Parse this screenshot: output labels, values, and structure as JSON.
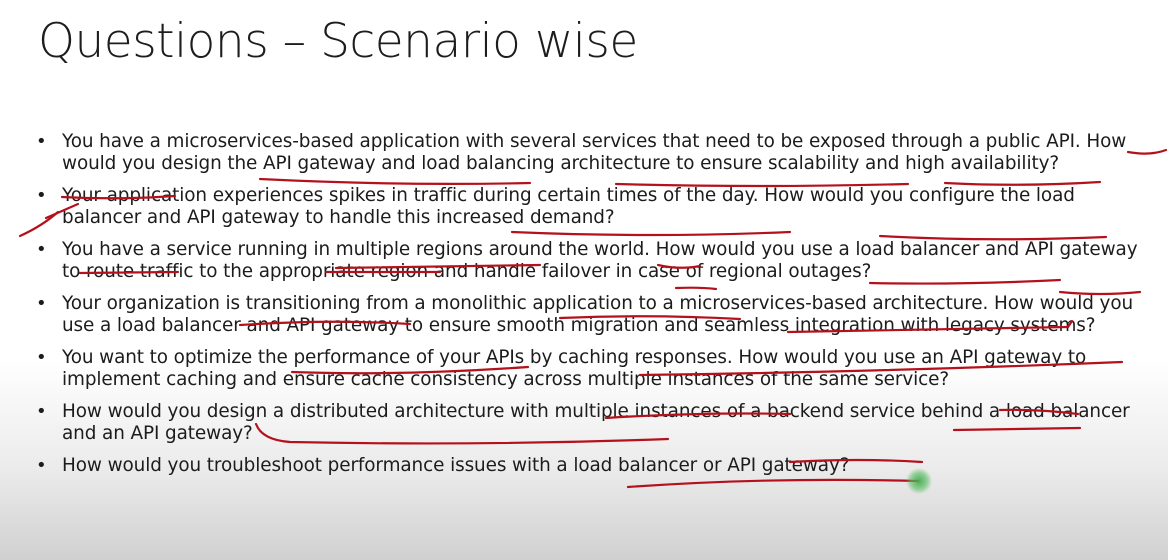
{
  "slide": {
    "title": "Questions – Scenario wise",
    "questions": [
      "You have a microservices-based application with several services that need to be exposed through a public API. How would you design the API gateway and load balancing architecture to ensure scalability and high availability?",
      "Your application experiences spikes in traffic during certain times of the day. How would you configure the load balancer and API gateway to handle this increased demand?",
      "You have a service running in multiple regions around the world. How would you use a load balancer and API gateway to route traffic to the appropriate region and handle failover in case of regional outages?",
      "Your organization is transitioning from a monolithic application to a microservices-based architecture. How would you use a load balancer and API gateway to ensure smooth migration and seamless integration with legacy systems?",
      "You want to optimize the performance of your APIs by caching responses. How would you use an API gateway to implement caching and ensure cache consistency across multiple instances of the same service?",
      "How would you design a distributed architecture with multiple instances of a backend service behind a load balancer and an API gateway?",
      "How would you troubleshoot performance issues with a load balancer or API gateway?"
    ]
  },
  "colors": {
    "annotation": "#b3121c",
    "pointer": "#4caf50"
  }
}
